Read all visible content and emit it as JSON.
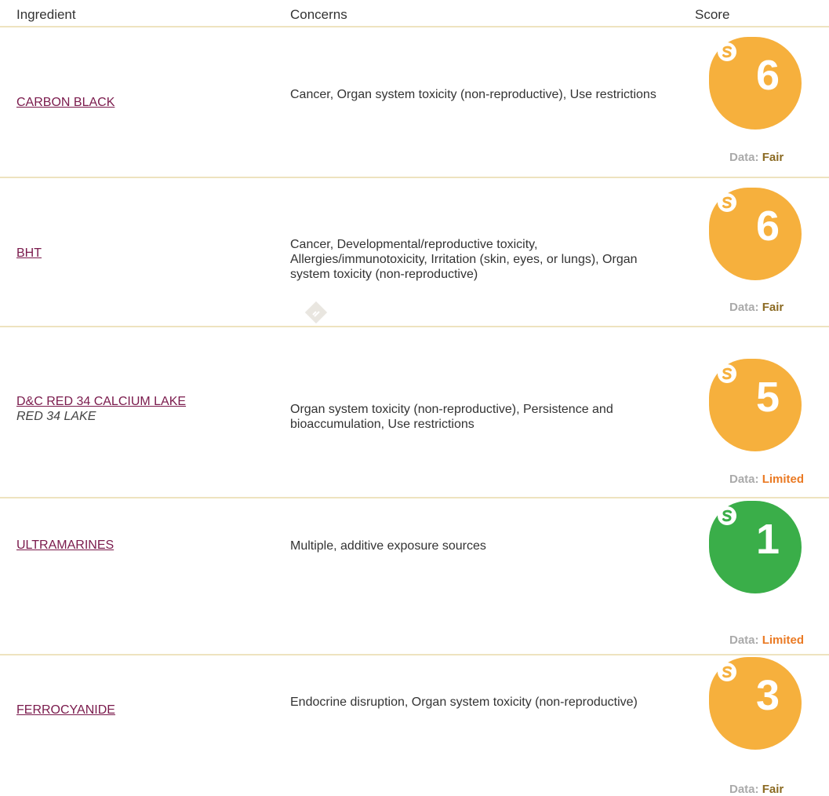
{
  "header": {
    "ingredient": "Ingredient",
    "concerns": "Concerns",
    "score": "Score"
  },
  "data_prefix": "Data:",
  "rows": [
    {
      "ingredient": "CARBON BLACK",
      "concerns": "Cancer, Organ system toxicity (non-reproductive), Use restrictions",
      "score": "6",
      "score_color": "#f6b03d",
      "data_quality": "Fair"
    },
    {
      "ingredient": "BHT",
      "concerns": "Cancer, Developmental/reproductive toxicity, Allergies/immunotoxicity, Irritation (skin, eyes, or lungs), Organ system toxicity (non-reproductive)",
      "score": "6",
      "score_color": "#f6b03d",
      "data_quality": "Fair"
    },
    {
      "ingredient": "D&C RED 34 CALCIUM LAKE",
      "alt_name": "RED 34 LAKE",
      "concerns": "Organ system toxicity (non-reproductive), Persistence and bioaccumulation, Use restrictions",
      "score": "5",
      "score_color": "#f6b03d",
      "data_quality": "Limited"
    },
    {
      "ingredient": "ULTRAMARINES",
      "concerns": "Multiple, additive exposure sources",
      "score": "1",
      "score_color": "#3aae49",
      "data_quality": "Limited"
    },
    {
      "ingredient": "FERROCYANIDE",
      "concerns": "Endocrine disruption, Organ system toxicity (non-reproductive)",
      "score": "3",
      "score_color": "#f6b03d",
      "data_quality": "Fair"
    }
  ],
  "colors": {
    "link": "#7a1a4c",
    "divider": "#eee3bf",
    "quality_fair": "#8b6a22",
    "quality_limited": "#ea7a24"
  },
  "icons": {
    "score_badge_icon": "s-circle-icon",
    "watermark": "diamond-logo-icon"
  }
}
